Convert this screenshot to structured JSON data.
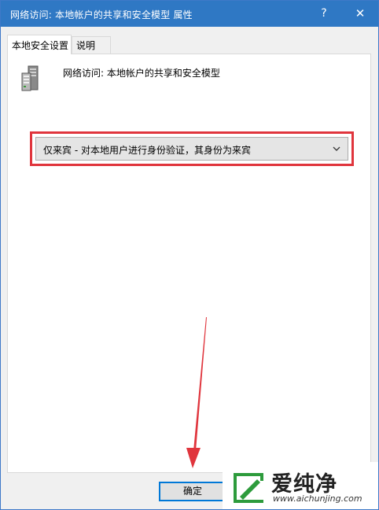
{
  "window": {
    "title": "网络访问: 本地帐户的共享和安全模型 属性",
    "help_glyph": "?",
    "close_glyph": "✕"
  },
  "tabs": [
    {
      "label": "本地安全设置",
      "active": true
    },
    {
      "label": "说明",
      "active": false
    }
  ],
  "policy": {
    "icon": "server-icon",
    "title": "网络访问: 本地帐户的共享和安全模型"
  },
  "dropdown": {
    "selected": "仅来宾 - 对本地用户进行身份验证，其身份为来宾",
    "icon": "chevron-down-icon"
  },
  "highlight_color": "#e0353d",
  "buttons": {
    "ok_label": "确定"
  },
  "watermark": {
    "text": "爱纯净",
    "url": "www.aichunjing.com",
    "brand_color": "#2d9b3c"
  }
}
